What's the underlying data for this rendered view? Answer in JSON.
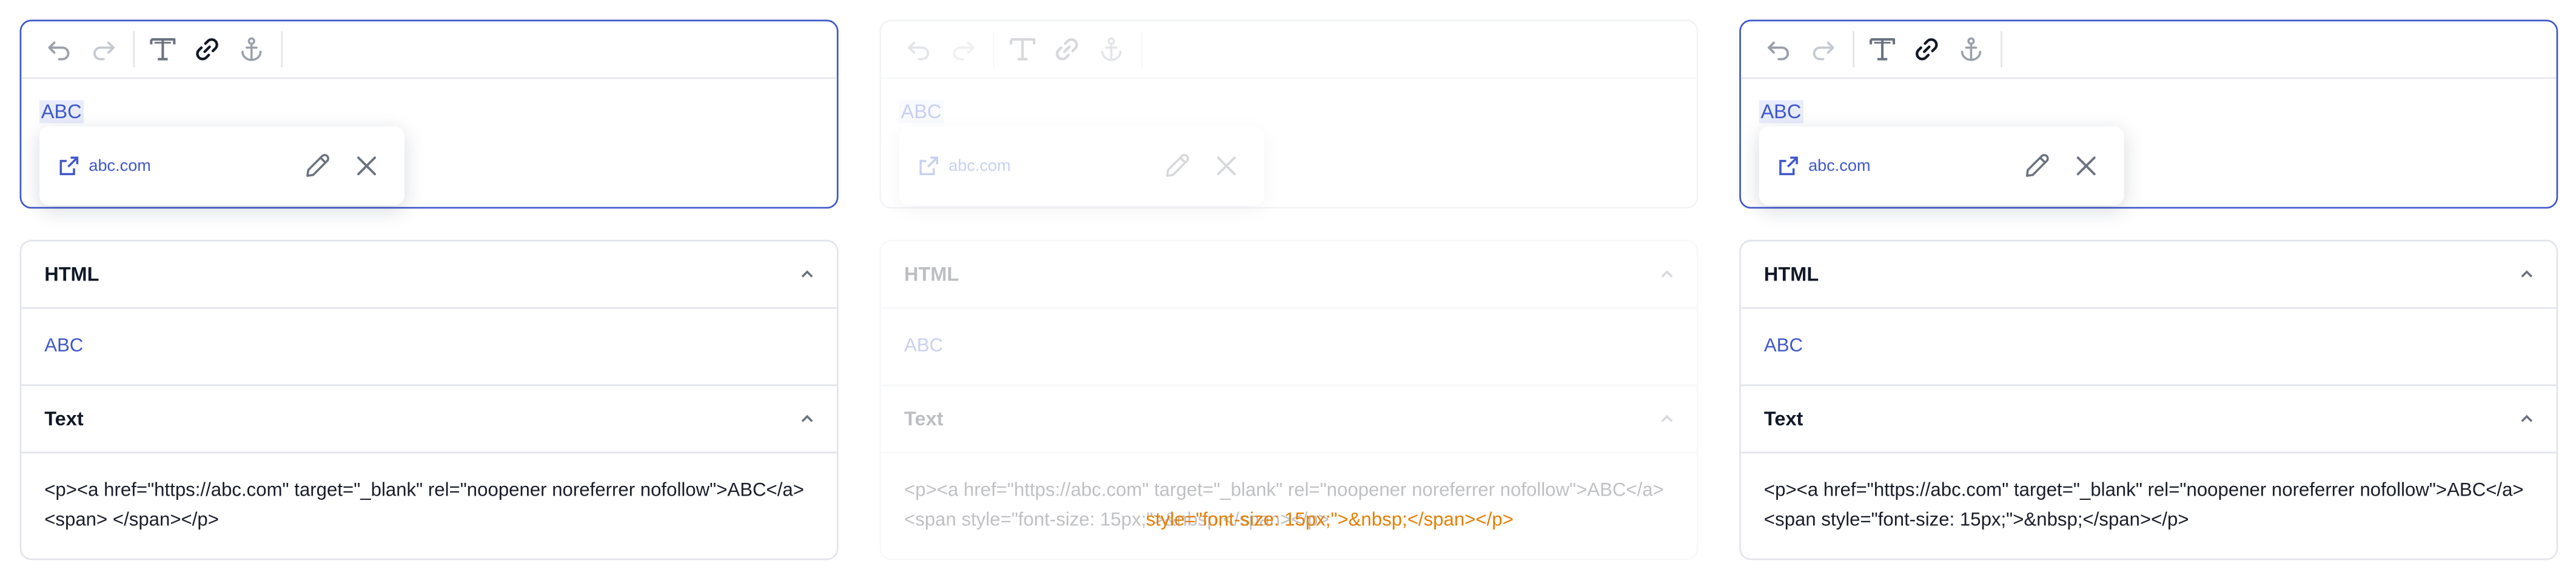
{
  "toolbar": {
    "undo_icon": "undo-icon",
    "redo_icon": "redo-icon",
    "text_format_icon": "text-format-icon",
    "link_icon": "link-icon",
    "anchor_icon": "anchor-icon"
  },
  "editor": {
    "content_text": "ABC",
    "popover_url": "abc.com"
  },
  "accordion": {
    "html_title": "HTML",
    "html_rendered": "ABC",
    "text_title": "Text"
  },
  "panels": [
    {
      "serialized": "<p><a href=\"https://abc.com\" target=\"_blank\" rel=\"noopener noreferrer nofollow\">ABC</a><span> </span></p>"
    },
    {
      "serialized": "<p><a href=\"https://abc.com\" target=\"_blank\" rel=\"noopener noreferrer nofollow\">ABC</a><span style=\"font-size: 15px;\">&nbsp;</span></p>"
    },
    {
      "serialized": "<p><a href=\"https://abc.com\" target=\"_blank\" rel=\"noopener noreferrer nofollow\">ABC</a><span style=\"font-size: 15px;\">&nbsp;</span></p>"
    }
  ],
  "overlay": {
    "diff_text": "style=\"font-size: 15px;\">&nbsp;</span></p>"
  },
  "colors": {
    "accent": "#3f57c9",
    "overlay": "#e67e00"
  }
}
